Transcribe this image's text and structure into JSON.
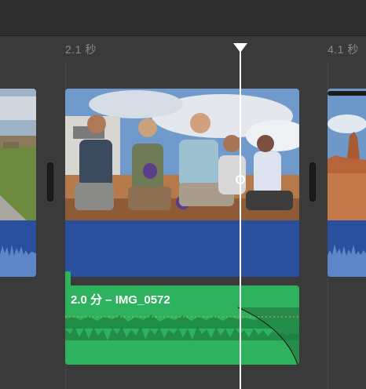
{
  "ruler": {
    "left_label": "2.1 秒",
    "right_label": "4.1 秒"
  },
  "music_clip": {
    "title": "2.0 分 – IMG_0572"
  },
  "colors": {
    "background": "#3a3a3a",
    "video_audio_track": "#2a4f9e",
    "music_track": "#2fb25e",
    "playhead": "#ffffff"
  },
  "icons": {
    "playhead": "playhead-triangle-icon",
    "trim_handle": "trim-handle-icon"
  }
}
